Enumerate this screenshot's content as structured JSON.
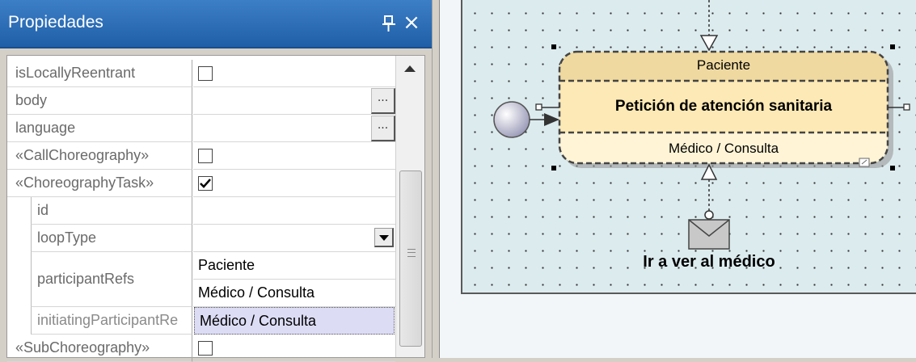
{
  "panel": {
    "title": "Propiedades",
    "pin_icon": "pin-icon",
    "close_icon": "close-icon",
    "close_glyph": "×"
  },
  "properties": {
    "isLocallyReentrant": {
      "label": "isLocallyReentrant",
      "checked": false
    },
    "body": {
      "label": "body",
      "button": "..."
    },
    "language": {
      "label": "language",
      "button": "..."
    },
    "callChoreography": {
      "label": "«CallChoreography»",
      "checked": false
    },
    "choreographyTask": {
      "label": "«ChoreographyTask»",
      "checked": true
    },
    "id": {
      "label": "id",
      "value": ""
    },
    "loopType": {
      "label": "loopType",
      "value": ""
    },
    "participantRefs": {
      "label": "participantRefs",
      "values": [
        "Paciente",
        "Médico / Consulta"
      ]
    },
    "initiatingParticipantRef": {
      "label": "initiatingParticipantRe",
      "value": "Médico / Consulta"
    },
    "subChoreography": {
      "label": "«SubChoreography»",
      "checked": false
    }
  },
  "diagram": {
    "task": {
      "top_participant": "Paciente",
      "name": "Petición de atención sanitaria",
      "bottom_participant": "Médico / Consulta"
    },
    "message_label": "Ir a ver al médico"
  },
  "colors": {
    "title_bar": "#2f6fb8",
    "selected_row": "#dcdcf5",
    "pool_fill": "#dcebee",
    "task_band": "#f3e3b0"
  }
}
